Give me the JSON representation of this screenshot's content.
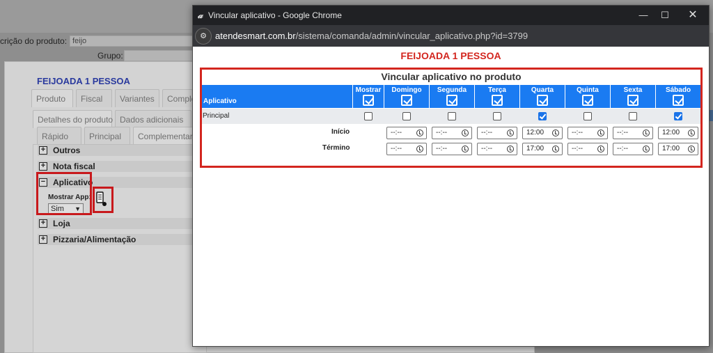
{
  "background": {
    "description_label": "crição do produto:",
    "description_value": "feijo",
    "group_label": "Grupo:"
  },
  "product_dialog": {
    "title": "FEIJOADA 1 PESSOA",
    "tabs_top": [
      "Produto",
      "Fiscal",
      "Variantes",
      "Complem"
    ],
    "tabs_mid": [
      "Detalhes do produto",
      "Dados adicionais"
    ],
    "tabs_low": [
      "Rápido",
      "Principal",
      "Complementar"
    ],
    "sections": [
      "Outros",
      "Nota fiscal",
      "Aplicativo",
      "Loja",
      "Pizzaria/Alimentação"
    ],
    "mostrar_app_label": "Mostrar App:",
    "mostrar_app_value": "Sim"
  },
  "popup": {
    "window_title": "Vincular aplicativo - Google Chrome",
    "url_domain": "atendesmart.com.br",
    "url_path": "/sistema/comanda/admin/vincular_aplicativo.php?id=3799",
    "product_title": "FEIJOADA 1 PESSOA",
    "grid_title": "Vincular aplicativo no produto",
    "col_aplicativo": "Aplicativo",
    "columns": [
      "Mostrar",
      "Domingo",
      "Segunda",
      "Terça",
      "Quarta",
      "Quinta",
      "Sexta",
      "Sábado"
    ],
    "row_name": "Principal",
    "row_checked": [
      false,
      false,
      false,
      false,
      true,
      false,
      false,
      true
    ],
    "inicio_label": "Início",
    "termino_label": "Término",
    "inicio_values": [
      "--:--",
      "--:--",
      "--:--",
      "12:00",
      "--:--",
      "--:--",
      "12:00"
    ],
    "termino_values": [
      "--:--",
      "--:--",
      "--:--",
      "17:00",
      "--:--",
      "--:--",
      "17:00"
    ]
  },
  "colors": {
    "header_blue": "#1a7bf2",
    "highlight_red": "#d3261f",
    "title_blue": "#2a3a9e"
  }
}
